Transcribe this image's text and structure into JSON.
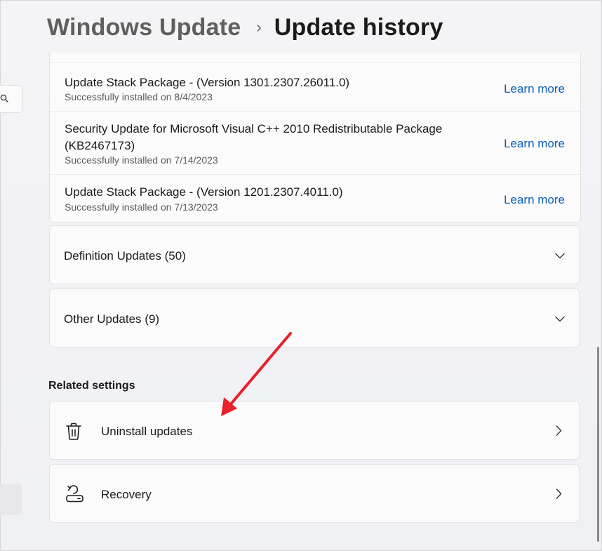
{
  "header": {
    "parent": "Windows Update",
    "separator": "›",
    "current": "Update history"
  },
  "quality_updates": [
    {
      "title": "Update Stack Package - (Version 1301.2307.26011.0)",
      "status": "Successfully installed on 8/4/2023",
      "link": "Learn more"
    },
    {
      "title_line1": "Security Update for Microsoft Visual C++ 2010 Redistributable Package",
      "title_line2": "(KB2467173)",
      "status": "Successfully installed on 7/14/2023",
      "link": "Learn more"
    },
    {
      "title": "Update Stack Package - (Version 1201.2307.4011.0)",
      "status": "Successfully installed on 7/13/2023",
      "link": "Learn more"
    }
  ],
  "expanders": [
    {
      "label": "Definition Updates (50)",
      "icon": "chevron-down-icon"
    },
    {
      "label": "Other Updates (9)",
      "icon": "chevron-down-icon"
    }
  ],
  "related": {
    "title": "Related settings",
    "items": [
      {
        "label": "Uninstall updates",
        "icon": "trash-icon"
      },
      {
        "label": "Recovery",
        "icon": "recovery-icon"
      }
    ]
  },
  "colors": {
    "link": "#0a5fb4",
    "annotation_arrow": "#e8212b"
  }
}
